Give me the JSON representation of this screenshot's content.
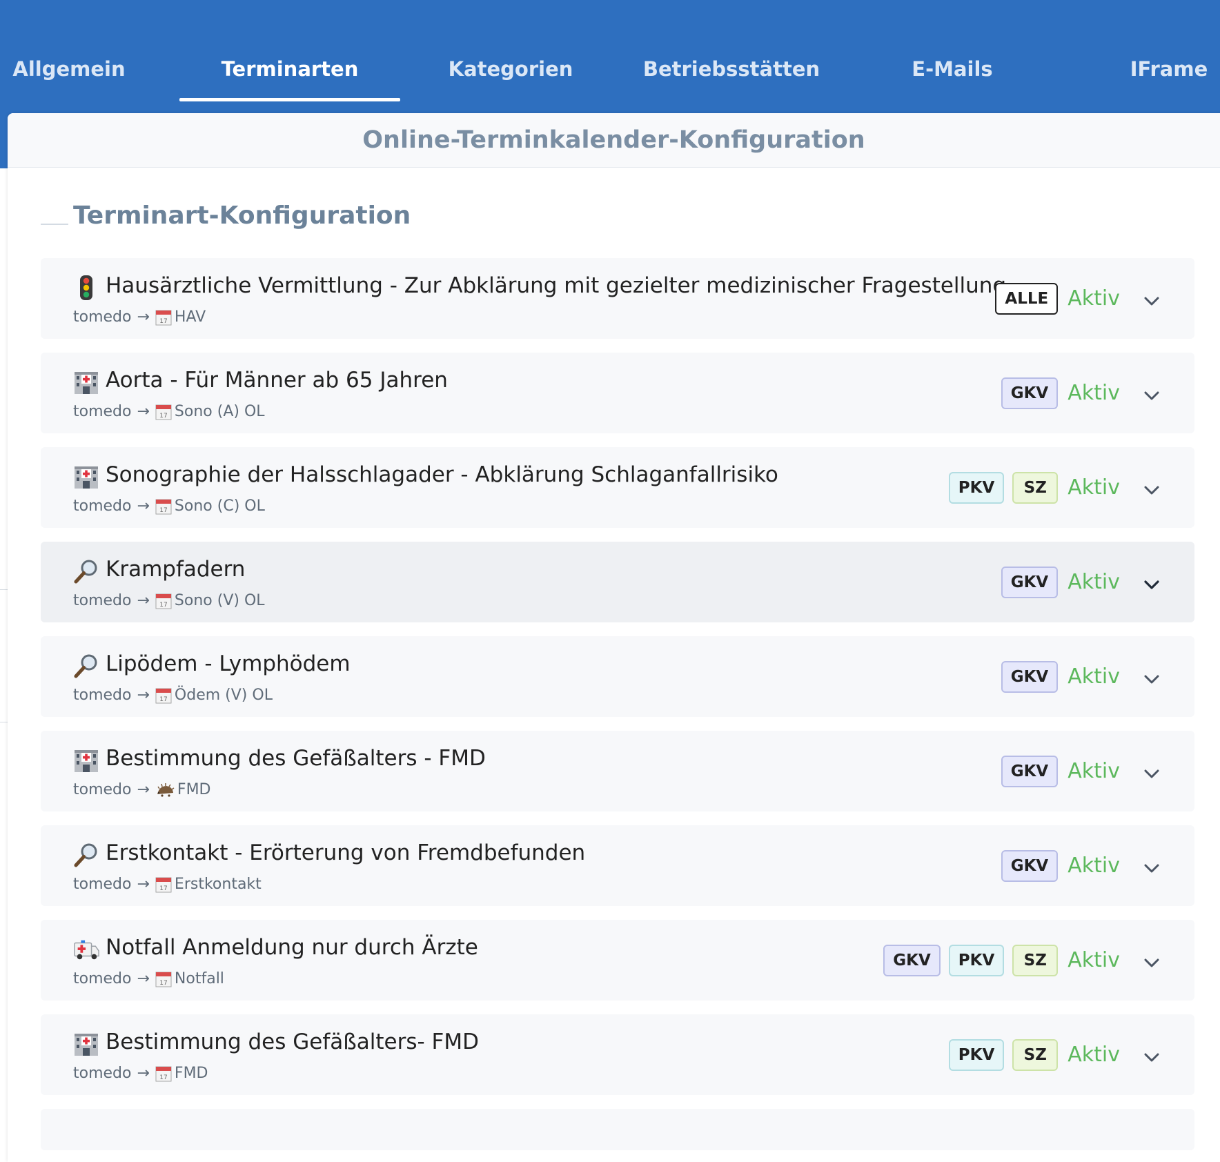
{
  "tabs": [
    {
      "label": "Allgemein",
      "active": false
    },
    {
      "label": "Terminarten",
      "active": true
    },
    {
      "label": "Kategorien",
      "active": false
    },
    {
      "label": "Betriebsstätten",
      "active": false
    },
    {
      "label": "E-Mails",
      "active": false
    },
    {
      "label": "IFrame",
      "active": false
    }
  ],
  "page_title": "Online-Terminkalender-Konfiguration",
  "section_title": "Terminart-Konfiguration",
  "colors": {
    "header_bg": "#2e6fbf",
    "active_status": "#5cb85c"
  },
  "rows": [
    {
      "icon": "traffic-light-icon",
      "title": "Hausärztliche Vermittlung - Zur Abklärung mit gezielter medizinischer Fragestellung",
      "source": "tomedo",
      "arrow": "→",
      "target_icon": "calendar-icon",
      "target": "HAV",
      "badges": [
        "ALLE"
      ],
      "status": "Aktiv"
    },
    {
      "icon": "hospital-icon",
      "title": "Aorta - Für Männer ab 65 Jahren",
      "source": "tomedo",
      "arrow": "→",
      "target_icon": "calendar-icon",
      "target": "Sono (A) OL",
      "badges": [
        "GKV"
      ],
      "status": "Aktiv"
    },
    {
      "icon": "hospital-icon",
      "title": "Sonographie der Halsschlagader - Abklärung Schlaganfallrisiko",
      "source": "tomedo",
      "arrow": "→",
      "target_icon": "calendar-icon",
      "target": "Sono (C) OL",
      "badges": [
        "PKV",
        "SZ"
      ],
      "status": "Aktiv"
    },
    {
      "icon": "magnifier-icon",
      "title": "Krampfadern",
      "source": "tomedo",
      "arrow": "→",
      "target_icon": "calendar-icon",
      "target": "Sono (V) OL",
      "badges": [
        "GKV"
      ],
      "status": "Aktiv"
    },
    {
      "icon": "magnifier-icon",
      "title": "Lipödem - Lymphödem",
      "source": "tomedo",
      "arrow": "→",
      "target_icon": "calendar-icon",
      "target": "Ödem (V) OL",
      "badges": [
        "GKV"
      ],
      "status": "Aktiv"
    },
    {
      "icon": "hospital-icon",
      "title": "Bestimmung des Gefäßalters - FMD",
      "source": "tomedo",
      "arrow": "→",
      "target_icon": "hedgehog-icon",
      "target": "FMD",
      "badges": [
        "GKV"
      ],
      "status": "Aktiv"
    },
    {
      "icon": "magnifier-icon",
      "title": "Erstkontakt - Erörterung von Fremdbefunden",
      "source": "tomedo",
      "arrow": "→",
      "target_icon": "calendar-icon",
      "target": "Erstkontakt",
      "badges": [
        "GKV"
      ],
      "status": "Aktiv"
    },
    {
      "icon": "ambulance-icon",
      "title": "Notfall Anmeldung nur durch Ärzte",
      "source": "tomedo",
      "arrow": "→",
      "target_icon": "calendar-icon",
      "target": "Notfall",
      "badges": [
        "GKV",
        "PKV",
        "SZ"
      ],
      "status": "Aktiv"
    },
    {
      "icon": "hospital-icon",
      "title": "Bestimmung des Gefäßalters- FMD",
      "source": "tomedo",
      "arrow": "→",
      "target_icon": "calendar-icon",
      "target": "FMD",
      "badges": [
        "PKV",
        "SZ"
      ],
      "status": "Aktiv"
    }
  ]
}
